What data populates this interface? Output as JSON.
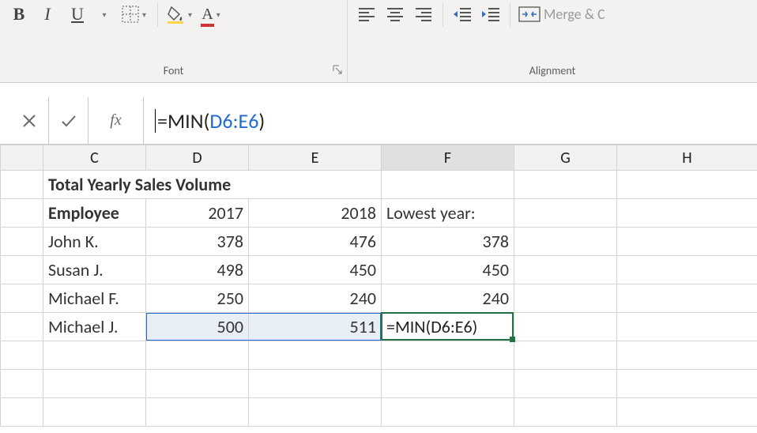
{
  "ribbon": {
    "font_group_label": "Font",
    "alignment_group_label": "Alignment",
    "bold": "B",
    "italic": "I",
    "underline": "U",
    "font_color_letter": "A",
    "merge_label": "Merge & C"
  },
  "formula_bar": {
    "fx_label": "fx",
    "prefix": "=MIN(",
    "range": "D6:E6",
    "suffix": ")"
  },
  "columns": [
    "",
    "C",
    "D",
    "E",
    "F",
    "G",
    "H"
  ],
  "data": {
    "title": "Total Yearly Sales Volume",
    "header_employee": "Employee",
    "year1": "2017",
    "year2": "2018",
    "lowest_label": "Lowest year:",
    "rows": [
      {
        "name": "John K.",
        "y1": "378",
        "y2": "476",
        "low": "378"
      },
      {
        "name": "Susan J.",
        "y1": "498",
        "y2": "450",
        "low": "450"
      },
      {
        "name": "Michael F.",
        "y1": "250",
        "y2": "240",
        "low": "240"
      },
      {
        "name": "Michael J.",
        "y1": "500",
        "y2": "511",
        "low": "=MIN(D6:E6)"
      }
    ]
  }
}
